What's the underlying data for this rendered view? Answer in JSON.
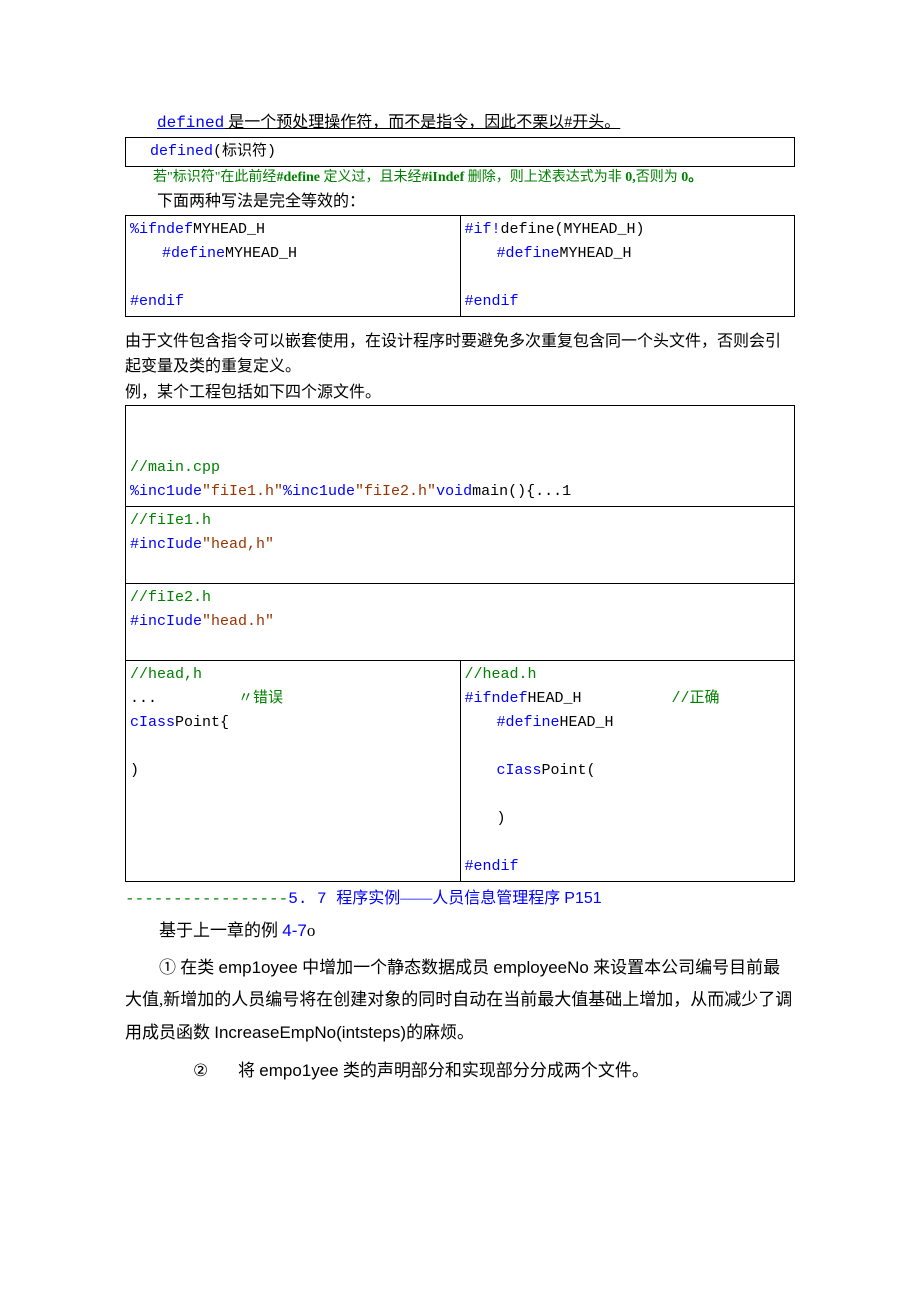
{
  "line1_pre": "defined",
  "line1_post": " 是一个预处理操作符，而不是指令，因此不栗以#开头。",
  "table_defined_pre": "defined",
  "table_defined_post": "(标识符)",
  "line2_a": "若\"标识符\"在此前经",
  "line2_b": "#define",
  "line2_c": " 定义过，且未经",
  "line2_d": "#iIndef",
  "line2_e": " 删除，则上述表达式为非 ",
  "line2_f": "0,",
  "line2_g": "否则为 ",
  "line2_h": "0。",
  "line3": "下面两种写法是完全等效的：",
  "tA_l1_a": "%ifndef",
  "tA_l1_b": "MYHEAD_H",
  "tA_l2_a": "#define",
  "tA_l2_b": "MYHEAD_H",
  "tA_l3": "#endif",
  "tA_r1_a": "#if!",
  "tA_r1_b": "define(MYHEAD_H)",
  "tA_r2_a": "#define",
  "tA_r2_b": "MYHEAD_H",
  "tA_r3": "#endif",
  "para2a": "由于文件包含指令可以嵌套使用，在设计程序时要避免多次重复包含同一个头文件，否则会引起变量及类的重复定义。",
  "para2b": "例，某个工程包括如下四个源文件。",
  "r1_a": "//main.cpp",
  "r1b_a": "%inc1ude",
  "r1b_b": "\"fiIe1.h\"",
  "r1b_c": "%inc1ude",
  "r1b_d": "\"fiIe2.h\"",
  "r1b_e": "void",
  "r1b_f": "main(){...1",
  "r2_a": "//fiIe1.h",
  "r2_b": "#incIude",
  "r2_c": "\"head,h\"",
  "r3_a": "//fiIe2.h",
  "r3_b": "#incIude",
  "r3_c": "\"head.h\"",
  "r4L_a": "//head,h",
  "r4L_b": "...         ",
  "r4L_c": "〃错误",
  "r4L_d": "cIass",
  "r4L_e": "Point{",
  "r4L_f": ")",
  "r4R_a": "//head.h",
  "r4R_b": "#ifndef",
  "r4R_c": "HEAD_H",
  "r4R_d": "//正确",
  "r4R_e": "#define",
  "r4R_f": "HEAD_H",
  "r4R_g": "cIass",
  "r4R_h": "Point(",
  "r4R_i": ")",
  "r4R_j": "#endif",
  "sec_dashes": "-----------------",
  "sec_num": "5. 7 ",
  "sec_label": "程序实例——人员信息管理程序 ",
  "sec_page": "P151",
  "base_a": "基于上一章的例 ",
  "base_b": "4-7",
  "base_c": "o",
  "item1_a": "① 在类 ",
  "item1_b": "emp1oyee",
  "item1_c": " 中增加一个静态数据成员 ",
  "item1_d": "employeeNo",
  "item1_e": " 来设置本公司编号目前最大值,新增加的人员编号将在创建对象的同时自动在当前最大值基础上增加，从而减少了调用成员函数 ",
  "item1_f": "IncreaseEmpNo(intsteps)",
  "item1_g": "的麻烦。",
  "item2_n": "②",
  "item2_a": "将 ",
  "item2_b": "empo1yee",
  "item2_c": " 类的声明部分和实现部分分成两个文件。"
}
